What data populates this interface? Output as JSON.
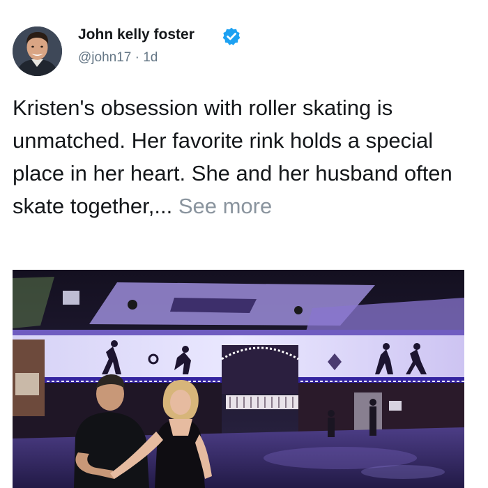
{
  "tweet": {
    "author_name": "John kelly foster",
    "verified": true,
    "handle": "@john17",
    "separator": "·",
    "age": "1d",
    "text": "Kristen's obsession with roller skating is unmatched. Her favorite rink holds a special place in her heart. She and her husband often skate together,...",
    "see_more_label": "See more"
  },
  "icons": {
    "verified": "verified-badge-icon"
  },
  "colors": {
    "verified_blue": "#1da1f2",
    "name_text": "#14171a",
    "meta_text": "#657786",
    "see_more": "#8a949e"
  }
}
